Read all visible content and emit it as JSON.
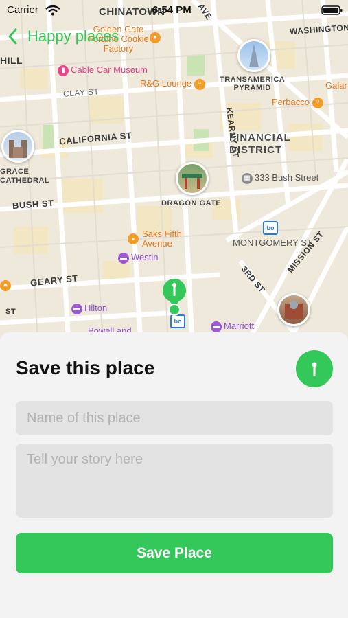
{
  "status_bar": {
    "carrier": "Carrier",
    "time": "6:54 PM",
    "icons": [
      "wifi-icon",
      "battery-icon"
    ]
  },
  "nav": {
    "back_label": "Happy places",
    "back_icon": "chevron-left-icon"
  },
  "map": {
    "streets": [
      "CHINATOWN",
      "WASHINGTON",
      "CLAY ST",
      "CALIFORNIA ST",
      "KEARNY ST",
      "BUSH ST",
      "GEARY ST",
      "MONTGOMERY ST",
      "3RD ST",
      "MISSION ST",
      "AVE",
      "HILL",
      "ST"
    ],
    "districts": {
      "financial": "FINANCIAL\nDISTRICT"
    },
    "landmarks": {
      "transamerica": "TRANSAMERICA\nPYRAMID",
      "grace": "GRACE\nCATHEDRAL",
      "dragon_gate": "DRAGON GATE"
    },
    "pois": {
      "golden_gate_fortune": "Golden Gate\nFortune Cookie\nFactory",
      "cable_car_museum": "Cable Car Museum",
      "rg_lounge": "R&G Lounge",
      "perbacco": "Perbacco",
      "galar": "Galar",
      "bush_street": "333 Bush Street",
      "saks": "Saks Fifth\nAvenue",
      "westin": "Westin",
      "hilton": "Hilton",
      "marriott": "Marriott",
      "powell": "Powell and"
    },
    "colors": {
      "accent": "#34c759",
      "orange": "#e8771d",
      "purple": "#8a4fd0"
    }
  },
  "sheet": {
    "title": "Save this place",
    "title_icon": "location-pin-icon",
    "name_placeholder": "Name of this place",
    "story_placeholder": "Tell your story here",
    "save_label": "Save Place"
  }
}
